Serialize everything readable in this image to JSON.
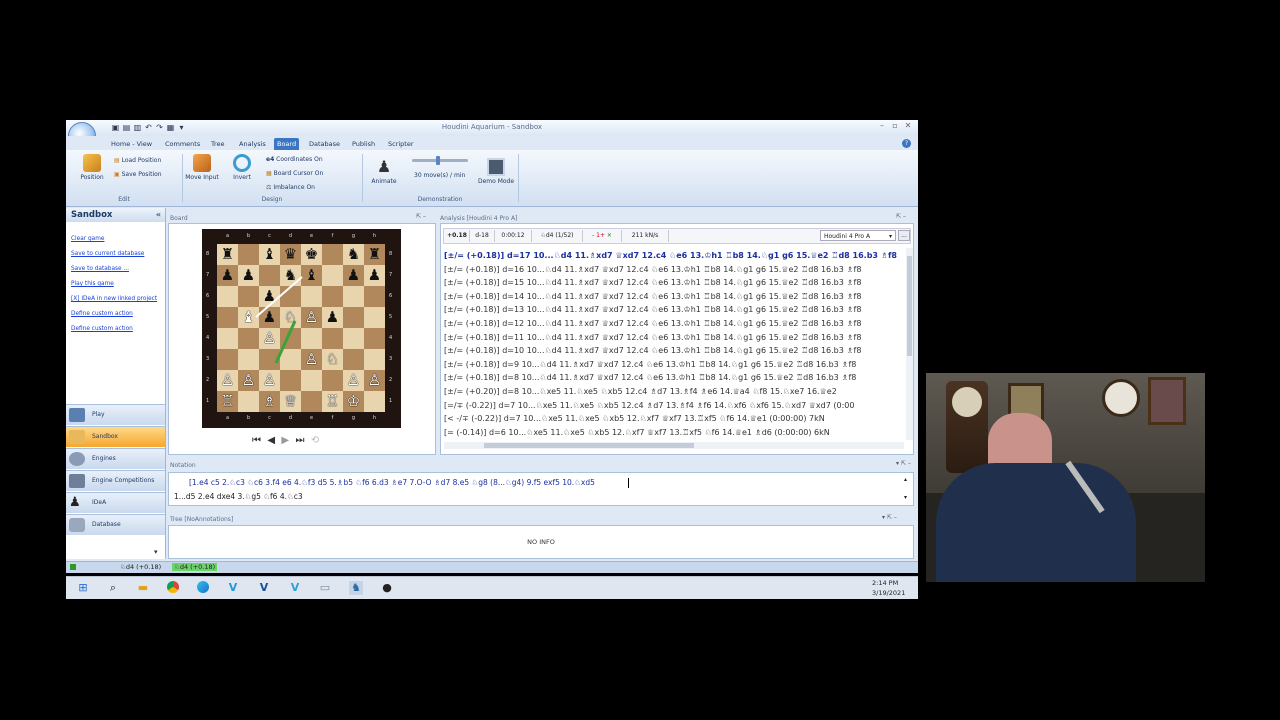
{
  "app": {
    "title": "Houdini Aquarium - Sandbox",
    "tabs": [
      "Home - View",
      "Comments",
      "Tree",
      "Analysis",
      "Board",
      "Database",
      "Publish",
      "Scripter"
    ],
    "active_tab": "Board"
  },
  "ribbon": {
    "edit": {
      "label": "Edit",
      "position": "Position",
      "load_position": "Load Position",
      "save_position": "Save Position"
    },
    "design": {
      "label": "Design",
      "move_input": "Move Input",
      "invert": "Invert",
      "coordinates": "Coordinates On",
      "board_cursor": "Board Cursor On",
      "imbalance": "Imbalance On"
    },
    "demonstration": {
      "label": "Demonstration",
      "animate": "Animate",
      "speed": "30 move(s) / min",
      "demo_mode": "Demo Mode"
    }
  },
  "sidebar": {
    "title": "Sandbox",
    "links": [
      "Clear game",
      "Save to current database",
      "Save to database ...",
      "Play this game",
      "[X] IDeA in new linked project",
      "Define custom action",
      "Define custom action"
    ],
    "nav": [
      "Play",
      "Sandbox",
      "Engines",
      "Engine Competitions",
      "IDeA",
      "Database"
    ],
    "active_nav": "Sandbox"
  },
  "board_panel": {
    "title": "Board",
    "files": [
      "a",
      "b",
      "c",
      "d",
      "e",
      "f",
      "g",
      "h"
    ],
    "ranks": [
      "8",
      "7",
      "6",
      "5",
      "4",
      "3",
      "2",
      "1"
    ],
    "rows": [
      [
        "♜",
        "",
        "♝",
        "♛",
        "♚",
        "",
        "♞",
        "♜"
      ],
      [
        "♟",
        "♟",
        "",
        "♞",
        "♝",
        "",
        "♟",
        "♟"
      ],
      [
        "",
        "",
        "",
        "",
        "",
        "",
        "",
        ""
      ],
      [
        "",
        "",
        "",
        "",
        "",
        "",
        "",
        ""
      ],
      [
        "",
        "",
        "",
        "",
        "",
        "",
        "",
        ""
      ],
      [
        "",
        "",
        "",
        "",
        "",
        "",
        "",
        ""
      ],
      [
        "",
        "",
        "",
        "",
        "",
        "",
        "",
        ""
      ],
      [
        "",
        "",
        "",
        "",
        "",
        "",
        "",
        ""
      ]
    ],
    "pieces": [
      {
        "sq": "a8",
        "p": "♜",
        "c": "b"
      },
      {
        "sq": "c8",
        "p": "♝",
        "c": "b"
      },
      {
        "sq": "d8",
        "p": "♛",
        "c": "b"
      },
      {
        "sq": "e8",
        "p": "♚",
        "c": "b"
      },
      {
        "sq": "g8",
        "p": "♞",
        "c": "b"
      },
      {
        "sq": "h8",
        "p": "♜",
        "c": "b"
      },
      {
        "sq": "a7",
        "p": "♟",
        "c": "b"
      },
      {
        "sq": "b7",
        "p": "♟",
        "c": "b"
      },
      {
        "sq": "d7",
        "p": "♞",
        "c": "b"
      },
      {
        "sq": "e7",
        "p": "♝",
        "c": "b"
      },
      {
        "sq": "g7",
        "p": "♟",
        "c": "b"
      },
      {
        "sq": "h7",
        "p": "♟",
        "c": "b"
      },
      {
        "sq": "c6",
        "p": "♟",
        "c": "b"
      },
      {
        "sq": "b5",
        "p": "♝",
        "c": "w"
      },
      {
        "sq": "c5",
        "p": "♟",
        "c": "b"
      },
      {
        "sq": "d5",
        "p": "♘",
        "c": "w"
      },
      {
        "sq": "e5",
        "p": "♙",
        "c": "w"
      },
      {
        "sq": "f5",
        "p": "♟",
        "c": "b"
      },
      {
        "sq": "c4",
        "p": "♙",
        "c": "w"
      },
      {
        "sq": "e3",
        "p": "♙",
        "c": "w"
      },
      {
        "sq": "f3",
        "p": "♘",
        "c": "w"
      },
      {
        "sq": "a2",
        "p": "♙",
        "c": "w"
      },
      {
        "sq": "b2",
        "p": "♙",
        "c": "w"
      },
      {
        "sq": "c2",
        "p": "♙",
        "c": "w"
      },
      {
        "sq": "g2",
        "p": "♙",
        "c": "w"
      },
      {
        "sq": "h2",
        "p": "♙",
        "c": "w"
      },
      {
        "sq": "a1",
        "p": "♖",
        "c": "w"
      },
      {
        "sq": "c1",
        "p": "♗",
        "c": "w"
      },
      {
        "sq": "d1",
        "p": "♕",
        "c": "w"
      },
      {
        "sq": "f1",
        "p": "♖",
        "c": "w"
      },
      {
        "sq": "g1",
        "p": "♔",
        "c": "w"
      }
    ]
  },
  "analysis": {
    "title": "Analysis [Houdini 4 Pro A]",
    "eval": "+0.18",
    "depth": "d-18",
    "time": "0:00:12",
    "move": "♘d4 (1/52)",
    "count": "- 1+",
    "speed": "211 kN/s",
    "engine": "Houdini 4 Pro A",
    "lines": [
      "[±/= (+0.18)] d=17  10...♘d4 11.♗xd7 ♕xd7 12.c4 ♘e6 13.♔h1 ♖b8 14.♘g1 g6 15.♕e2 ♖d8 16.b3 ♗f8",
      "[±/= (+0.18)] d=16  10...♘d4 11.♗xd7 ♕xd7 12.c4 ♘e6 13.♔h1 ♖b8 14.♘g1 g6 15.♕e2 ♖d8 16.b3 ♗f8",
      "[±/= (+0.18)] d=15  10...♘d4 11.♗xd7 ♕xd7 12.c4 ♘e6 13.♔h1 ♖b8 14.♘g1 g6 15.♕e2 ♖d8 16.b3 ♗f8",
      "[±/= (+0.18)] d=14  10...♘d4 11.♗xd7 ♕xd7 12.c4 ♘e6 13.♔h1 ♖b8 14.♘g1 g6 15.♕e2 ♖d8 16.b3 ♗f8",
      "[±/= (+0.18)] d=13  10...♘d4 11.♗xd7 ♕xd7 12.c4 ♘e6 13.♔h1 ♖b8 14.♘g1 g6 15.♕e2 ♖d8 16.b3 ♗f8",
      "[±/= (+0.18)] d=12  10...♘d4 11.♗xd7 ♕xd7 12.c4 ♘e6 13.♔h1 ♖b8 14.♘g1 g6 15.♕e2 ♖d8 16.b3 ♗f8",
      "[±/= (+0.18)] d=11  10...♘d4 11.♗xd7 ♕xd7 12.c4 ♘e6 13.♔h1 ♖b8 14.♘g1 g6 15.♕e2 ♖d8 16.b3 ♗f8",
      "[±/= (+0.18)] d=10  10...♘d4 11.♗xd7 ♕xd7 12.c4 ♘e6 13.♔h1 ♖b8 14.♘g1 g6 15.♕e2 ♖d8 16.b3 ♗f8",
      "[±/= (+0.18)] d=9  10...♘d4 11.♗xd7 ♕xd7 12.c4 ♘e6 13.♔h1 ♖b8 14.♘g1 g6 15.♕e2 ♖d8 16.b3 ♗f8",
      "[±/= (+0.18)] d=8  10...♘d4 11.♗xd7 ♕xd7 12.c4 ♘e6 13.♔h1 ♖b8 14.♘g1 g6 15.♕e2 ♖d8 16.b3 ♗f8",
      "[±/= (+0.20)] d=8  10...♘xe5 11.♘xe5 ♘xb5 12.c4 ♗d7 13.♗f4 ♗e6 14.♕a4 ♘f8 15.♘xe7 16.♕e2",
      "[=/∓ (-0.22)] d=7  10...♘xe5 11.♘xe5 ♘xb5 12.c4 ♗d7 13.♗f4 ♗f6 14.♘xf6 ♘xf6 15.♘xd7 ♕xd7 (0:00",
      "[< -/∓ (-0.22)] d=7  10...♘xe5 11.♘xe5 ♘xb5 12.♘xf7 ♕xf7 13.♖xf5 ♘f6 14.♕e1 (0:00:00) 7kN",
      "[= (-0.14)] d=6  10...♘xe5 11.♘xe5 ♘xb5 12.♘xf7 ♕xf7 13.♖xf5 ♘f6 14.♕e1 ♗d6 (0:00:00) 6kN"
    ]
  },
  "notation": {
    "title": "Notation",
    "main_line": "[1.e4 c5 2.♘c3 ♘c6 3.f4 e6 4.♘f3 d5 5.♗b5 ♘f6 6.d3 ♗e7 7.O-O ♗d7 8.e5 ♘g8 (8...♘g4) 9.f5 exf5 10.♘xd5",
    "variation": "1...d5 2.e4 dxe4 3.♘g5 ♘f6 4.♘c3"
  },
  "tree": {
    "title": "Tree [NoAnnotations]",
    "empty": "NO INFO"
  },
  "status": {
    "text": "♘d4 (+0.18)",
    "eval": "♘d4 (+0.18)"
  },
  "taskbar": {
    "time": "2:14 PM",
    "date": "3/19/2021"
  }
}
